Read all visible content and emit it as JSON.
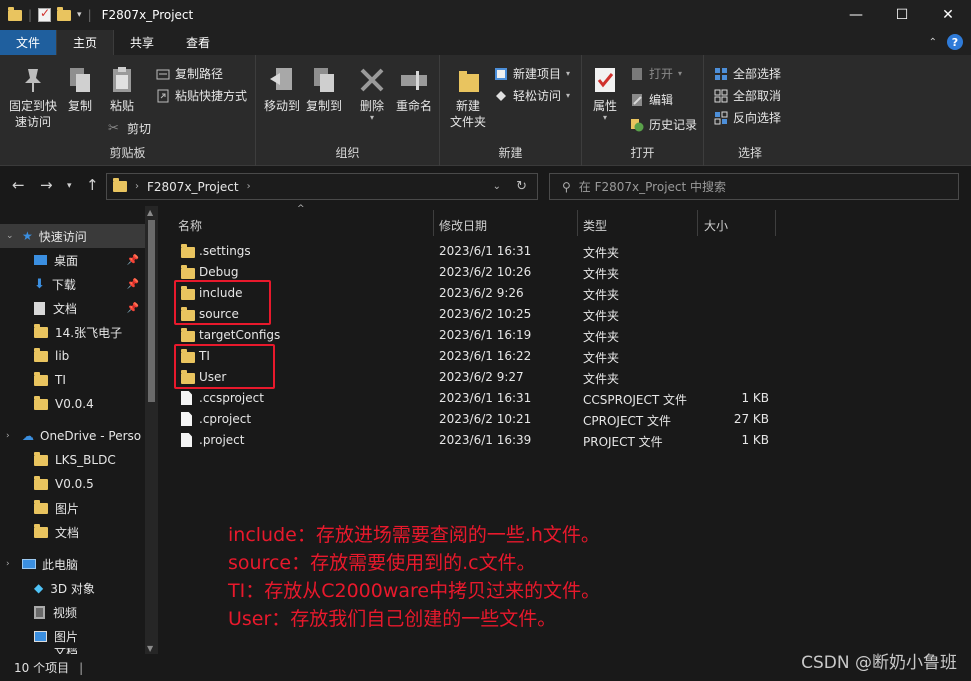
{
  "window": {
    "title": "F2807x_Project",
    "controls": {
      "minimize": "—",
      "maximize": "☐",
      "close": "✕"
    }
  },
  "ribbon_tabs": [
    {
      "label": "文件"
    },
    {
      "label": "主页"
    },
    {
      "label": "共享"
    },
    {
      "label": "查看"
    }
  ],
  "ribbon": {
    "clipboard": {
      "group": "剪贴板",
      "pin_quick": "固定到快\n速访问",
      "copy": "复制",
      "paste": "粘贴",
      "copy_path": "复制路径",
      "paste_shortcut": "粘贴快捷方式",
      "cut": "剪切"
    },
    "organize": {
      "group": "组织",
      "move_to": "移动到",
      "copy_to": "复制到",
      "delete": "删除",
      "rename": "重命名"
    },
    "new": {
      "group": "新建",
      "new_folder": "新建\n文件夹",
      "new_item": "新建项目",
      "easy_access": "轻松访问"
    },
    "open": {
      "group": "打开",
      "properties": "属性",
      "open": "打开",
      "edit": "编辑",
      "history": "历史记录"
    },
    "select": {
      "group": "选择",
      "select_all": "全部选择",
      "select_none": "全部取消",
      "invert": "反向选择"
    }
  },
  "address": {
    "path": "F2807x_Project",
    "search_placeholder": "在 F2807x_Project 中搜索"
  },
  "nav": [
    {
      "label": "快速访问",
      "icon": "star-icon",
      "pinned": false,
      "selected": true,
      "expand": true
    },
    {
      "label": "桌面",
      "icon": "desktop-icon",
      "pinned": true
    },
    {
      "label": "下载",
      "icon": "download-icon",
      "pinned": true
    },
    {
      "label": "文档",
      "icon": "document-icon",
      "pinned": true
    },
    {
      "label": "14.张飞电子",
      "icon": "folder-icon",
      "pinned": false
    },
    {
      "label": "lib",
      "icon": "folder-icon",
      "pinned": false
    },
    {
      "label": "TI",
      "icon": "folder-icon",
      "pinned": false
    },
    {
      "label": "V0.0.4",
      "icon": "folder-icon",
      "pinned": false
    },
    {
      "label": "OneDrive - Perso",
      "icon": "cloud-icon",
      "pinned": false,
      "expand": true
    },
    {
      "label": "LKS_BLDC",
      "icon": "folder-icon",
      "pinned": false
    },
    {
      "label": "V0.0.5",
      "icon": "folder-icon",
      "pinned": false
    },
    {
      "label": "图片",
      "icon": "folder-icon",
      "pinned": false
    },
    {
      "label": "文档",
      "icon": "folder-icon",
      "pinned": false
    },
    {
      "label": "此电脑",
      "icon": "computer-icon",
      "pinned": false,
      "expand": true
    },
    {
      "label": "3D 对象",
      "icon": "cube-icon",
      "pinned": false
    },
    {
      "label": "视频",
      "icon": "video-icon",
      "pinned": false
    },
    {
      "label": "图片",
      "icon": "picture-icon",
      "pinned": false
    },
    {
      "label": "文档",
      "icon": "document-icon",
      "pinned": false
    }
  ],
  "columns": {
    "name": "名称",
    "modified": "修改日期",
    "type": "类型",
    "size": "大小"
  },
  "files": [
    {
      "name": ".settings",
      "modified": "2023/6/1 16:31",
      "type": "文件夹",
      "size": "",
      "kind": "folder"
    },
    {
      "name": "Debug",
      "modified": "2023/6/2 10:26",
      "type": "文件夹",
      "size": "",
      "kind": "folder"
    },
    {
      "name": "include",
      "modified": "2023/6/2 9:26",
      "type": "文件夹",
      "size": "",
      "kind": "folder"
    },
    {
      "name": "source",
      "modified": "2023/6/2 10:25",
      "type": "文件夹",
      "size": "",
      "kind": "folder"
    },
    {
      "name": "targetConfigs",
      "modified": "2023/6/1 16:19",
      "type": "文件夹",
      "size": "",
      "kind": "folder"
    },
    {
      "name": "TI",
      "modified": "2023/6/1 16:22",
      "type": "文件夹",
      "size": "",
      "kind": "folder"
    },
    {
      "name": "User",
      "modified": "2023/6/2 9:27",
      "type": "文件夹",
      "size": "",
      "kind": "folder"
    },
    {
      "name": ".ccsproject",
      "modified": "2023/6/1 16:31",
      "type": "CCSPROJECT 文件",
      "size": "1 KB",
      "kind": "file"
    },
    {
      "name": ".cproject",
      "modified": "2023/6/2 10:21",
      "type": "CPROJECT 文件",
      "size": "27 KB",
      "kind": "file"
    },
    {
      "name": ".project",
      "modified": "2023/6/1 16:39",
      "type": "PROJECT 文件",
      "size": "1 KB",
      "kind": "file"
    }
  ],
  "annotations": [
    "include：存放进场需要查阅的一些.h文件。",
    "source：存放需要使用到的.c文件。",
    "TI：存放从C2000ware中拷贝过来的文件。",
    "User：存放我们自己创建的一些文件。"
  ],
  "status": {
    "count": "10 个项目"
  },
  "watermark": "CSDN @断奶小鲁班",
  "colors": {
    "annotation": "#e8192c",
    "folder": "#e9c45f",
    "file_tab": "#1f5f9e"
  }
}
